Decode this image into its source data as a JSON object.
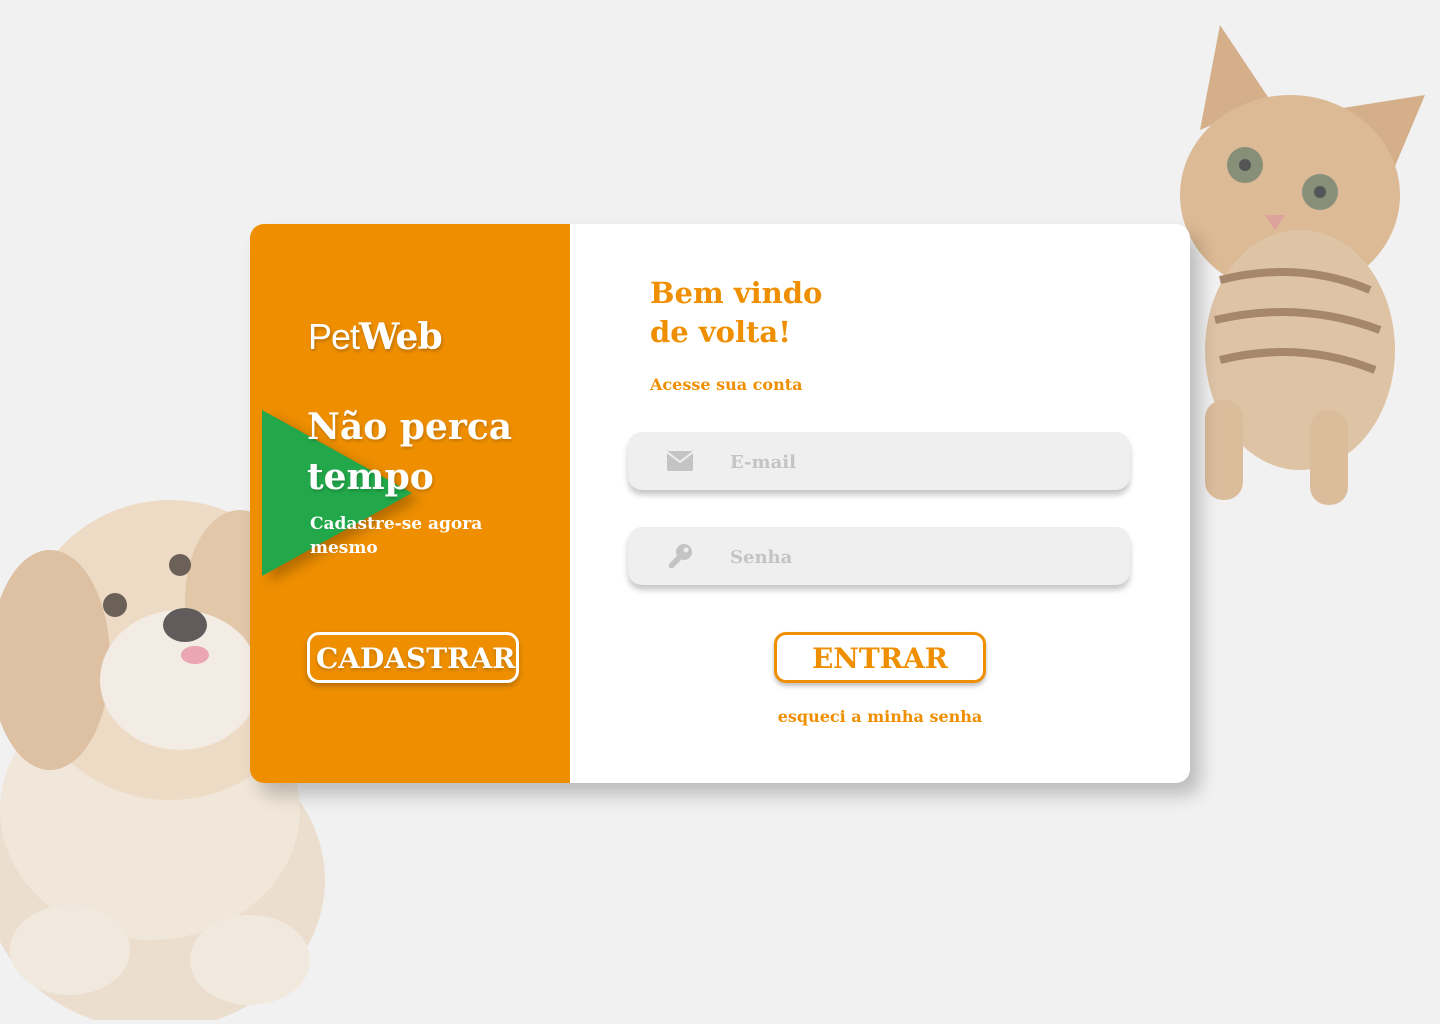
{
  "brand": {
    "logo_light": "Pet",
    "logo_bold": "Web"
  },
  "promo": {
    "title": "Não perca tempo",
    "subtitle": "Cadastre-se agora mesmo",
    "register_label": "CADASTRAR"
  },
  "login": {
    "welcome_line1": "Bem vindo",
    "welcome_line2": "de volta!",
    "subtitle": "Acesse sua conta",
    "email": {
      "placeholder": "E-mail",
      "value": "",
      "icon": "envelope-icon"
    },
    "password": {
      "placeholder": "Senha",
      "value": "",
      "icon": "key-icon"
    },
    "submit_label": "ENTRAR",
    "forgot_label": "esqueci a minha senha"
  },
  "colors": {
    "accent": "#ef8f00",
    "promo_arrow": "#22a84a",
    "background": "#f1f1f1"
  }
}
